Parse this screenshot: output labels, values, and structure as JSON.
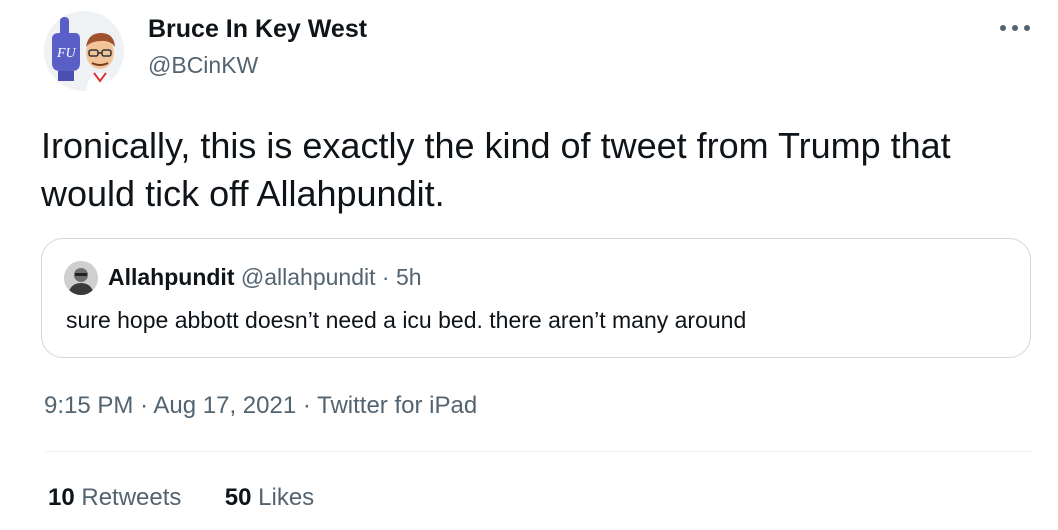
{
  "author": {
    "name": "Bruce In Key West",
    "handle": "@BCinKW",
    "avatar_icon": "cartoon-avatar-foam-finger-icon"
  },
  "more_icon": "more-options-icon",
  "tweet_text": "Ironically, this is exactly the kind of tweet from Trump that would tick off Allahpundit.",
  "quote": {
    "name": "Allahpundit",
    "handle": "@allahpundit",
    "separator": "·",
    "time": "5h",
    "text": "sure hope abbott doesn’t need a icu bed. there aren’t many around"
  },
  "meta": {
    "time": "9:15 PM",
    "sep1": "·",
    "date": "Aug 17, 2021",
    "sep2": "·",
    "source": "Twitter for iPad"
  },
  "stats": {
    "retweets_count": "10",
    "retweets_label": "Retweets",
    "likes_count": "50",
    "likes_label": "Likes"
  },
  "colors": {
    "text": "#0f1419",
    "secondary": "#536471",
    "border": "#cfd9de",
    "divider": "#eff3f4"
  }
}
